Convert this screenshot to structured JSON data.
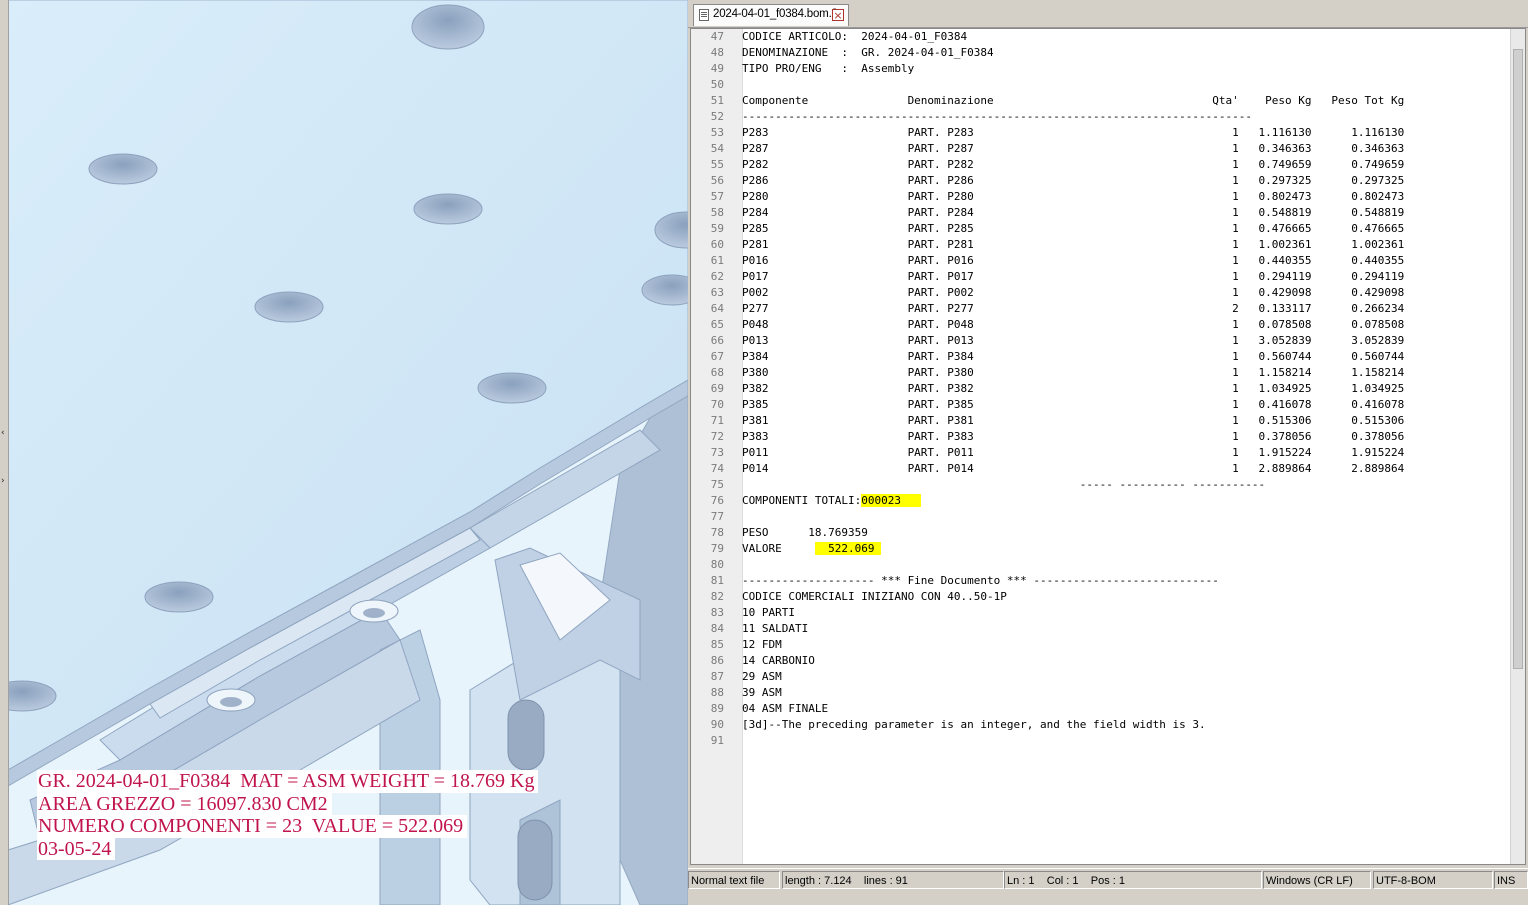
{
  "cad_overlay": {
    "lines": [
      "GR. 2024-04-01_F0384  MAT = ASM WEIGHT = 18.769 Kg",
      "AREA GREZZO = 16097.830 CM2",
      "NUMERO COMPONENTI = 23  VALUE = 522.069",
      "03-05-24"
    ],
    "text_color": "#c0144c"
  },
  "editor": {
    "tab": {
      "label": "2024-04-01_f0384.bom.3",
      "close_icon": "close-icon"
    },
    "lines": [
      {
        "n": "47",
        "text": "CODICE ARTICOLO:  2024-04-01_F0384"
      },
      {
        "n": "48",
        "text": "DENOMINAZIONE  :  GR. 2024-04-01_F0384"
      },
      {
        "n": "49",
        "text": "TIPO PRO/ENG   :  Assembly"
      },
      {
        "n": "50",
        "text": ""
      },
      {
        "n": "51",
        "text": "Componente               Denominazione                                 Qta'    Peso Kg   Peso Tot Kg"
      },
      {
        "n": "52",
        "text": "-----------------------------------------------------------------------------"
      },
      {
        "n": "53",
        "text": "P283                     PART. P283                                       1   1.116130      1.116130"
      },
      {
        "n": "54",
        "text": "P287                     PART. P287                                       1   0.346363      0.346363"
      },
      {
        "n": "55",
        "text": "P282                     PART. P282                                       1   0.749659      0.749659"
      },
      {
        "n": "56",
        "text": "P286                     PART. P286                                       1   0.297325      0.297325"
      },
      {
        "n": "57",
        "text": "P280                     PART. P280                                       1   0.802473      0.802473"
      },
      {
        "n": "58",
        "text": "P284                     PART. P284                                       1   0.548819      0.548819"
      },
      {
        "n": "59",
        "text": "P285                     PART. P285                                       1   0.476665      0.476665"
      },
      {
        "n": "60",
        "text": "P281                     PART. P281                                       1   1.002361      1.002361"
      },
      {
        "n": "61",
        "text": "P016                     PART. P016                                       1   0.440355      0.440355"
      },
      {
        "n": "62",
        "text": "P017                     PART. P017                                       1   0.294119      0.294119"
      },
      {
        "n": "63",
        "text": "P002                     PART. P002                                       1   0.429098      0.429098"
      },
      {
        "n": "64",
        "text": "P277                     PART. P277                                       2   0.133117      0.266234"
      },
      {
        "n": "65",
        "text": "P048                     PART. P048                                       1   0.078508      0.078508"
      },
      {
        "n": "66",
        "text": "P013                     PART. P013                                       1   3.052839      3.052839"
      },
      {
        "n": "67",
        "text": "P384                     PART. P384                                       1   0.560744      0.560744"
      },
      {
        "n": "68",
        "text": "P380                     PART. P380                                       1   1.158214      1.158214"
      },
      {
        "n": "69",
        "text": "P382                     PART. P382                                       1   1.034925      1.034925"
      },
      {
        "n": "70",
        "text": "P385                     PART. P385                                       1   0.416078      0.416078"
      },
      {
        "n": "71",
        "text": "P381                     PART. P381                                       1   0.515306      0.515306"
      },
      {
        "n": "72",
        "text": "P383                     PART. P383                                       1   0.378056      0.378056"
      },
      {
        "n": "73",
        "text": "P011                     PART. P011                                       1   1.915224      1.915224"
      },
      {
        "n": "74",
        "text": "P014                     PART. P014                                       1   2.889864      2.889864"
      },
      {
        "n": "75",
        "text": "                                                   ----- ---------- -----------"
      },
      {
        "n": "76",
        "text": "COMPONENTI TOTALI:",
        "hl": "000023   "
      },
      {
        "n": "77",
        "text": ""
      },
      {
        "n": "78",
        "text": "PESO      18.769359"
      },
      {
        "n": "79",
        "text": "VALORE     ",
        "hl": "  522.069 "
      },
      {
        "n": "80",
        "text": ""
      },
      {
        "n": "81",
        "text": "-------------------- *** Fine Documento *** ----------------------------"
      },
      {
        "n": "82",
        "text": "CODICE COMERCIALI INIZIANO CON 40..50-1P"
      },
      {
        "n": "83",
        "text": "10 PARTI"
      },
      {
        "n": "84",
        "text": "11 SALDATI"
      },
      {
        "n": "85",
        "text": "12 FDM"
      },
      {
        "n": "86",
        "text": "14 CARBONIO"
      },
      {
        "n": "87",
        "text": "29 ASM"
      },
      {
        "n": "88",
        "text": "39 ASM"
      },
      {
        "n": "89",
        "text": "04 ASM FINALE"
      },
      {
        "n": "90",
        "text": "[3d]--The preceding parameter is an integer, and the field width is 3."
      },
      {
        "n": "91",
        "text": ""
      }
    ],
    "highlight_color": "#ffff00"
  },
  "statusbar": {
    "file_type": "Normal text file",
    "length": "length : 7.124    lines : 91",
    "position": "Ln : 1    Col : 1    Pos : 1",
    "eol": "Windows (CR LF)",
    "encoding": "UTF-8-BOM",
    "mode": "INS"
  },
  "splitter": {
    "left_arrow": "‹",
    "right_arrow": "›"
  }
}
